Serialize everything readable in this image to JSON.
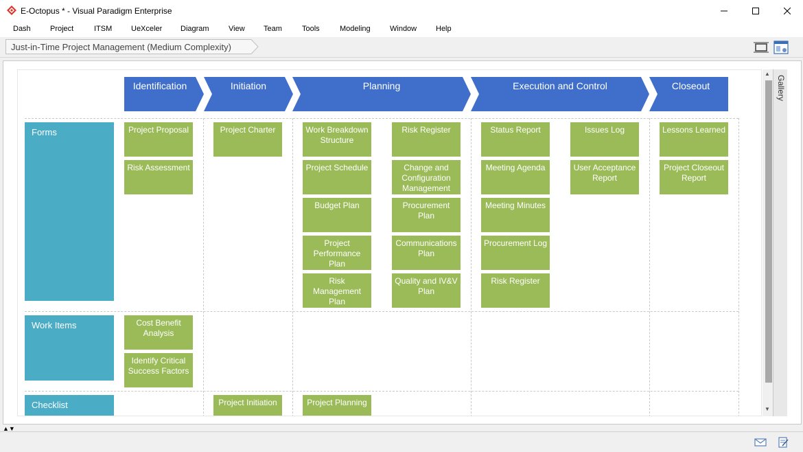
{
  "window": {
    "title": "E-Octopus * - Visual Paradigm Enterprise",
    "brand_color": "#d9362b"
  },
  "menu": [
    "Dash",
    "Project",
    "ITSM",
    "UeXceler",
    "Diagram",
    "View",
    "Team",
    "Tools",
    "Modeling",
    "Window",
    "Help"
  ],
  "breadcrumb": "Just-in-Time Project Management (Medium Complexity)",
  "phases": [
    "Identification",
    "Initiation",
    "Planning",
    "Execution and Control",
    "Closeout"
  ],
  "rows": [
    "Forms",
    "Work Items",
    "Checklist"
  ],
  "colors": {
    "phase": "#3f6fca",
    "row_header": "#4bacc6",
    "document": "#9bbb59"
  },
  "documents": {
    "forms_identification": [
      "Project Proposal",
      "Risk Assessment"
    ],
    "forms_initiation": [
      "Project Charter"
    ],
    "forms_planning_a": [
      "Work Breakdown Structure",
      "Project Schedule",
      "Budget Plan",
      "Project Performance Plan",
      "Risk Management Plan"
    ],
    "forms_planning_b": [
      "Risk Register",
      "Change and Configuration Management",
      "Procurement Plan",
      "Communications Plan",
      "Quality and IV&V Plan"
    ],
    "forms_execution_a": [
      "Status Report",
      "Meeting Agenda",
      "Meeting Minutes",
      "Procurement Log",
      "Risk Register"
    ],
    "forms_execution_b": [
      "Issues Log",
      "User Acceptance Report"
    ],
    "forms_closeout": [
      "Lessons Learned",
      "Project Closeout Report"
    ],
    "work_identification": [
      "Cost Benefit Analysis",
      "Identify Critical Success Factors"
    ],
    "check_initiation": [
      "Project Initiation"
    ],
    "check_planning": [
      "Project Planning"
    ]
  },
  "gallery_label": "Gallery",
  "icons": {
    "app": "visual-paradigm-logo",
    "minimize": "minimize-icon",
    "maximize": "maximize-icon",
    "close": "close-icon",
    "fit": "fit-diagram-icon",
    "panel": "panel-icon",
    "mail": "mail-icon",
    "note": "note-icon"
  }
}
